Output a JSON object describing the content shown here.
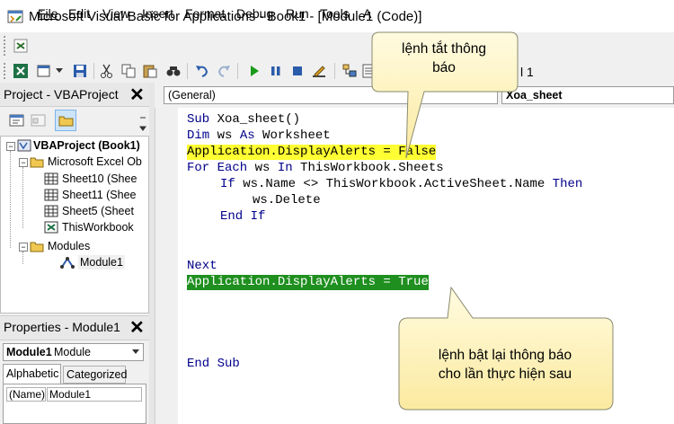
{
  "window": {
    "title": "Microsoft Visual Basic for Applications - Book1 - [Module1 (Code)]"
  },
  "menu": {
    "items": [
      "File",
      "Edit",
      "View",
      "Insert",
      "Format",
      "Debug",
      "Run",
      "Tools",
      "A"
    ]
  },
  "toolbar": {
    "line_indicator": "l 1"
  },
  "project_panel": {
    "title": "Project - VBAProject",
    "tree": {
      "root": "VBAProject (Book1)",
      "excel_objects_folder": "Microsoft Excel Ob",
      "sheets": [
        "Sheet10 (Shee",
        "Sheet11 (Shee",
        "Sheet5 (Sheet"
      ],
      "workbook": "ThisWorkbook",
      "modules_folder": "Modules",
      "module": "Module1"
    }
  },
  "properties_panel": {
    "title": "Properties - Module1",
    "object_name": "Module1",
    "object_type": "Module",
    "tabs": [
      "Alphabetic",
      "Categorized"
    ],
    "row_name": "(Name)",
    "row_value": "Module1"
  },
  "editor": {
    "object_combo": "(General)",
    "procedure_combo": "Xoa_sheet",
    "code": {
      "l1_kw": "Sub",
      "l1_rest": " Xoa_sheet()",
      "l2_kw": "Dim",
      "l2_mid": " ws ",
      "l2_kw2": "As",
      "l2_rest": " Worksheet",
      "l3": "Application.DisplayAlerts = False",
      "l4_kw": "For Each",
      "l4_mid": " ws ",
      "l4_kw2": "In",
      "l4_rest": " ThisWorkbook.Sheets",
      "l5_kw": "If",
      "l5_mid": " ws.Name <> ThisWorkbook.ActiveSheet.Name ",
      "l5_kw2": "Then",
      "l6": "ws.Delete",
      "l7": "End If",
      "l8": "Next",
      "l9": "Application.DisplayAlerts = True",
      "l10": "End Sub"
    }
  },
  "callouts": {
    "top_line1": "lệnh tắt thông",
    "top_line2": "báo",
    "bottom_line1": "lệnh bật lại thông báo",
    "bottom_line2": "cho lần thực hiện sau"
  }
}
